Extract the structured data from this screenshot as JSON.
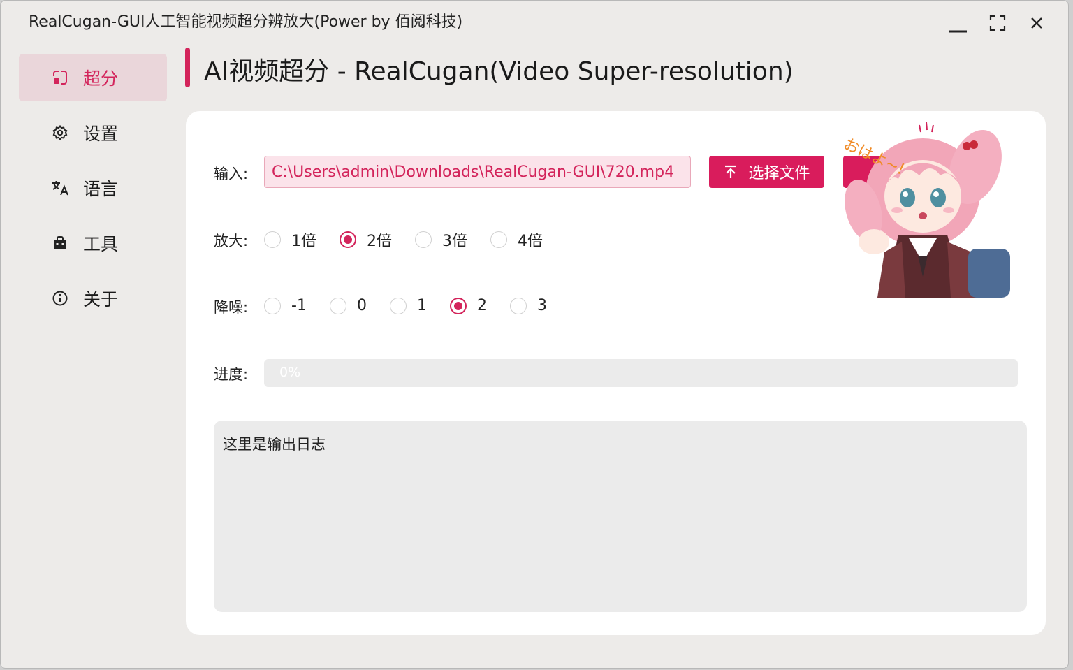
{
  "window": {
    "title": "RealCugan-GUI人工智能视频超分辨放大(Power by 佰阅科技)"
  },
  "sidebar": {
    "items": [
      {
        "label": "超分",
        "icon": "super-resolution-icon",
        "active": true
      },
      {
        "label": "设置",
        "icon": "gear-icon",
        "active": false
      },
      {
        "label": "语言",
        "icon": "translate-icon",
        "active": false
      },
      {
        "label": "工具",
        "icon": "toolbox-icon",
        "active": false
      },
      {
        "label": "关于",
        "icon": "info-icon",
        "active": false
      }
    ]
  },
  "page": {
    "title": "AI视频超分 - RealCugan(Video Super-resolution)"
  },
  "form": {
    "input_label": "输入:",
    "input_value": "C:\\Users\\admin\\Downloads\\RealCugan-GUI\\720.mp4",
    "choose_file_label": "选择文件",
    "scale_label": "放大:",
    "scale_options": [
      "1倍",
      "2倍",
      "3倍",
      "4倍"
    ],
    "scale_selected": "2倍",
    "denoise_label": "降噪:",
    "denoise_options": [
      "-1",
      "0",
      "1",
      "2",
      "3"
    ],
    "denoise_selected": "2",
    "progress_label": "进度:",
    "progress_text": "0%",
    "progress_fraction": 0
  },
  "log": {
    "text": "这里是输出日志"
  },
  "mascot": {
    "caption": "おはよ~!"
  },
  "colors": {
    "accent": "#d3245b",
    "window_bg": "#edebe9",
    "card_bg": "#ffffff",
    "active_nav_bg": "#ead6da"
  }
}
